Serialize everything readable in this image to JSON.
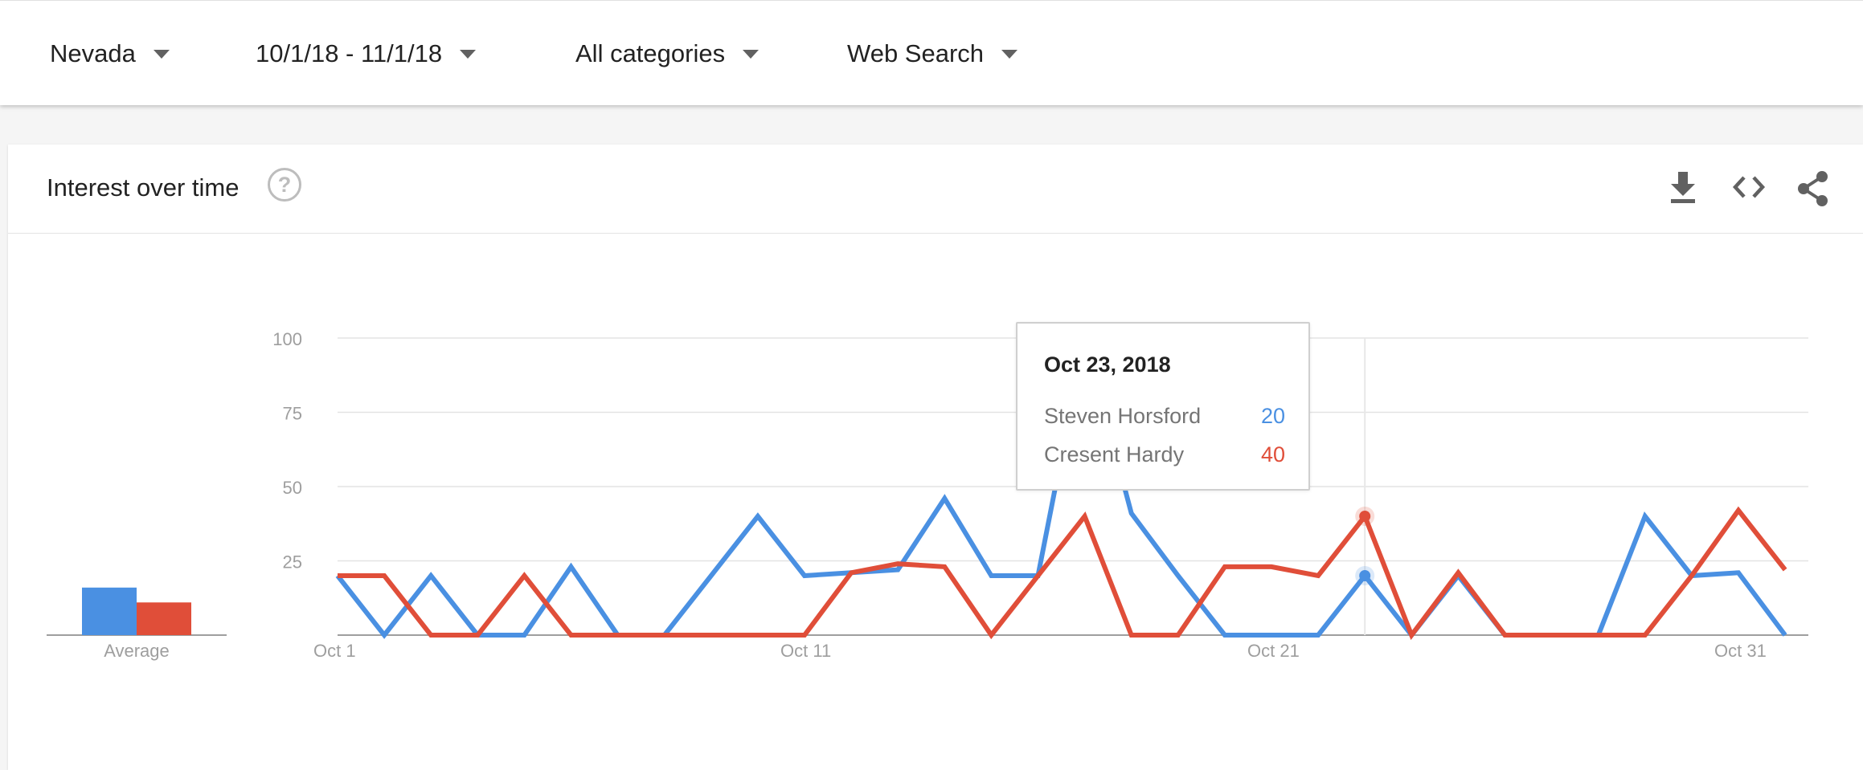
{
  "filters": {
    "region": "Nevada",
    "date_range": "10/1/18 - 11/1/18",
    "category": "All categories",
    "property": "Web Search"
  },
  "card": {
    "title": "Interest over time"
  },
  "icons": [
    "help-icon",
    "download-icon",
    "embed-code-icon",
    "share-icon",
    "chevron-down-icon"
  ],
  "colors": {
    "series_blue": "#4a90e2",
    "series_red": "#e04e39",
    "grid": "#e3e3e3",
    "axis_text": "#9e9e9e"
  },
  "tooltip": {
    "date": "Oct 23, 2018",
    "rows": [
      {
        "name": "Steven Horsford",
        "value": "20"
      },
      {
        "name": "Cresent Hardy",
        "value": "40"
      }
    ]
  },
  "chart_data": {
    "type": "line",
    "x_start_label": "Oct 1",
    "xtick_labels": [
      "Oct 1",
      "Oct 11",
      "Oct 21",
      "Oct 31"
    ],
    "ytick_labels": [
      "100",
      "75",
      "50",
      "25"
    ],
    "ylim": [
      0,
      100
    ],
    "grid": true,
    "highlight_label": "Oct 23",
    "x": [
      "Oct 1",
      "Oct 2",
      "Oct 3",
      "Oct 4",
      "Oct 5",
      "Oct 6",
      "Oct 7",
      "Oct 8",
      "Oct 9",
      "Oct 10",
      "Oct 11",
      "Oct 12",
      "Oct 13",
      "Oct 14",
      "Oct 15",
      "Oct 16",
      "Oct 17",
      "Oct 18",
      "Oct 19",
      "Oct 20",
      "Oct 21",
      "Oct 22",
      "Oct 23",
      "Oct 24",
      "Oct 25",
      "Oct 26",
      "Oct 27",
      "Oct 28",
      "Oct 29",
      "Oct 30",
      "Oct 31",
      "Nov 1"
    ],
    "series": [
      {
        "name": "Steven Horsford",
        "color": "#4a90e2",
        "values": [
          20,
          0,
          20,
          0,
          0,
          23,
          0,
          0,
          20,
          40,
          20,
          21,
          22,
          46,
          20,
          20,
          100,
          41,
          20,
          0,
          0,
          0,
          20,
          0,
          20,
          0,
          0,
          0,
          40,
          20,
          21,
          0
        ]
      },
      {
        "name": "Cresent Hardy",
        "color": "#e04e39",
        "values": [
          20,
          20,
          0,
          0,
          20,
          0,
          0,
          0,
          0,
          0,
          0,
          21,
          24,
          23,
          0,
          20,
          40,
          0,
          0,
          23,
          23,
          20,
          40,
          0,
          21,
          0,
          0,
          0,
          0,
          20,
          42,
          22
        ]
      }
    ],
    "averages": {
      "label": "Average",
      "values": [
        16,
        11
      ]
    }
  }
}
